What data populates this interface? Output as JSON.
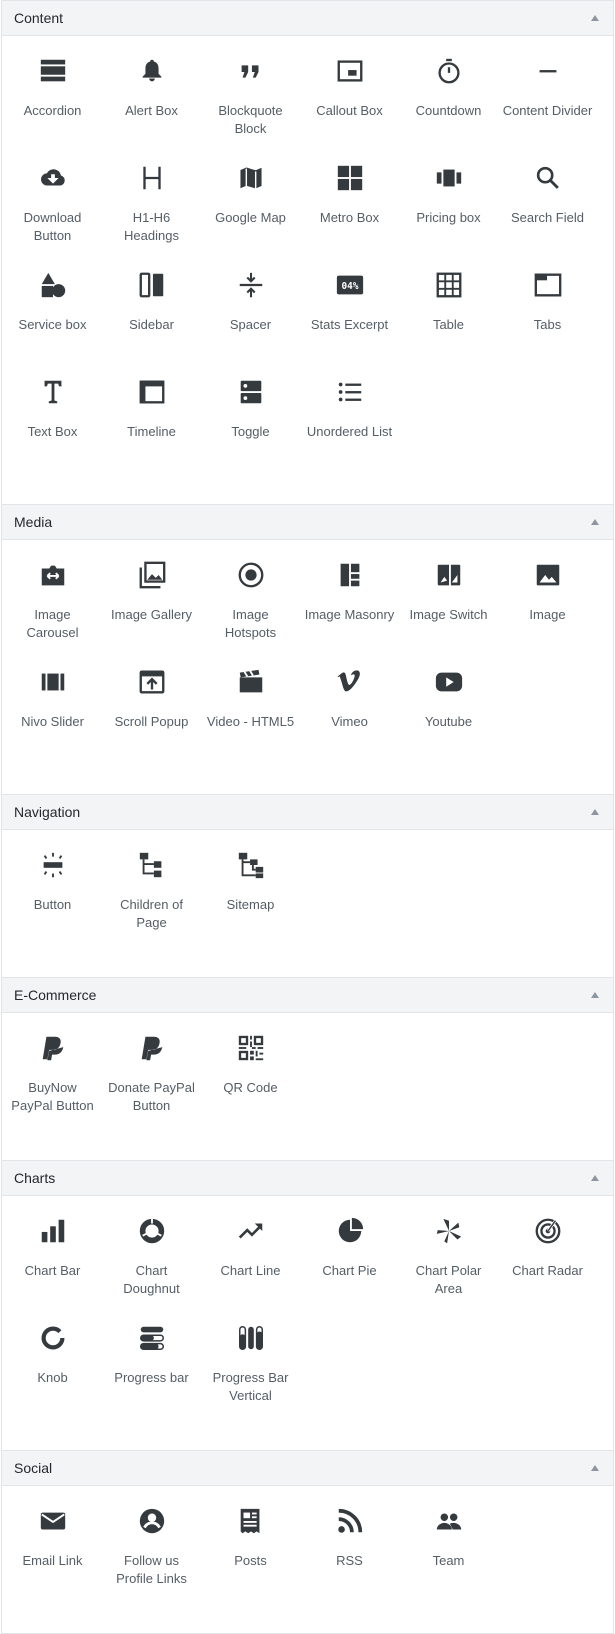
{
  "panels": [
    {
      "title": "Content",
      "items": [
        {
          "label": "Accordion",
          "icon": "accordion-icon"
        },
        {
          "label": "Alert Box",
          "icon": "bell-icon"
        },
        {
          "label": "Blockquote Block",
          "icon": "quote-icon"
        },
        {
          "label": "Callout Box",
          "icon": "callout-icon"
        },
        {
          "label": "Countdown",
          "icon": "stopwatch-icon"
        },
        {
          "label": "Content Divider",
          "icon": "divider-icon"
        },
        {
          "label": "Download Button",
          "icon": "cloud-download-icon"
        },
        {
          "label": "H1-H6 Headings",
          "icon": "heading-icon"
        },
        {
          "label": "Google Map",
          "icon": "map-icon"
        },
        {
          "label": "Metro Box",
          "icon": "grid-icon"
        },
        {
          "label": "Pricing box",
          "icon": "pricing-icon"
        },
        {
          "label": "Search Field",
          "icon": "search-icon"
        },
        {
          "label": "Service box",
          "icon": "shapes-icon"
        },
        {
          "label": "Sidebar",
          "icon": "sidebar-icon"
        },
        {
          "label": "Spacer",
          "icon": "spacer-icon"
        },
        {
          "label": "Stats Excerpt",
          "icon": "stats-icon"
        },
        {
          "label": "Table",
          "icon": "table-icon"
        },
        {
          "label": "Tabs",
          "icon": "tabs-icon"
        },
        {
          "label": "Text Box",
          "icon": "text-icon"
        },
        {
          "label": "Timeline",
          "icon": "timeline-icon"
        },
        {
          "label": "Toggle",
          "icon": "toggle-icon"
        },
        {
          "label": "Unordered List",
          "icon": "list-icon"
        }
      ]
    },
    {
      "title": "Media",
      "items": [
        {
          "label": "Image Carousel",
          "icon": "carousel-icon"
        },
        {
          "label": "Image Gallery",
          "icon": "gallery-icon"
        },
        {
          "label": "Image Hotspots",
          "icon": "hotspot-icon"
        },
        {
          "label": "Image Masonry",
          "icon": "masonry-icon"
        },
        {
          "label": "Image Switch",
          "icon": "switch-icon"
        },
        {
          "label": "Image",
          "icon": "image-icon"
        },
        {
          "label": "Nivo Slider",
          "icon": "slider-icon"
        },
        {
          "label": "Scroll Popup",
          "icon": "popup-icon"
        },
        {
          "label": "Video - HTML5",
          "icon": "video-icon"
        },
        {
          "label": "Vimeo",
          "icon": "vimeo-icon"
        },
        {
          "label": "Youtube",
          "icon": "youtube-icon"
        }
      ]
    },
    {
      "title": "Navigation",
      "items": [
        {
          "label": "Button",
          "icon": "button-icon"
        },
        {
          "label": "Children of Page",
          "icon": "tree-icon"
        },
        {
          "label": "Sitemap",
          "icon": "sitemap-icon"
        }
      ]
    },
    {
      "title": "E-Commerce",
      "items": [
        {
          "label": "BuyNow PayPal Button",
          "icon": "paypal-icon"
        },
        {
          "label": "Donate PayPal Button",
          "icon": "paypal-icon"
        },
        {
          "label": "QR Code",
          "icon": "qr-icon"
        }
      ]
    },
    {
      "title": "Charts",
      "items": [
        {
          "label": "Chart Bar",
          "icon": "bar-chart-icon"
        },
        {
          "label": "Chart Doughnut",
          "icon": "doughnut-chart-icon"
        },
        {
          "label": "Chart Line",
          "icon": "line-chart-icon"
        },
        {
          "label": "Chart Pie",
          "icon": "pie-chart-icon"
        },
        {
          "label": "Chart Polar Area",
          "icon": "polar-chart-icon"
        },
        {
          "label": "Chart Radar",
          "icon": "radar-chart-icon"
        },
        {
          "label": "Knob",
          "icon": "knob-icon"
        },
        {
          "label": "Progress bar",
          "icon": "progress-bar-icon"
        },
        {
          "label": "Progress Bar Vertical",
          "icon": "progress-vertical-icon"
        }
      ]
    },
    {
      "title": "Social",
      "items": [
        {
          "label": "Email Link",
          "icon": "email-icon"
        },
        {
          "label": "Follow us Profile Links",
          "icon": "profile-icon"
        },
        {
          "label": "Posts",
          "icon": "posts-icon"
        },
        {
          "label": "RSS",
          "icon": "rss-icon"
        },
        {
          "label": "Team",
          "icon": "team-icon"
        }
      ]
    }
  ]
}
